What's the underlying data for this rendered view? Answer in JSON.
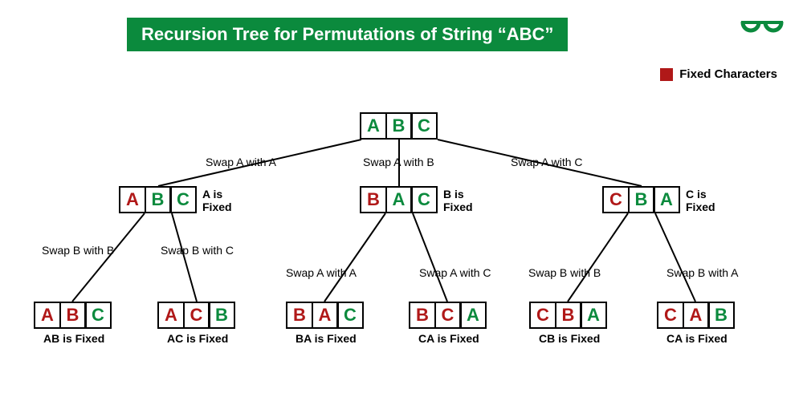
{
  "title": "Recursion Tree for Permutations of String “ABC”",
  "legend": {
    "label": "Fixed Characters",
    "color": "#b01818"
  },
  "chart_data": {
    "type": "tree",
    "description": "Recursion tree showing how the string ABC is permuted by fixing one character at each level and swapping the rest.",
    "root": {
      "cells": [
        {
          "char": "A",
          "fixed": false
        },
        {
          "char": "B",
          "fixed": false
        },
        {
          "char": "C",
          "fixed": false
        }
      ],
      "children": [
        {
          "edge_label": "Swap A with A",
          "side_label": "A is Fixed",
          "cells": [
            {
              "char": "A",
              "fixed": true
            },
            {
              "char": "B",
              "fixed": false
            },
            {
              "char": "C",
              "fixed": false
            }
          ],
          "children": [
            {
              "edge_label": "Swap B with B",
              "leaf_label": "AB is Fixed",
              "cells": [
                {
                  "char": "A",
                  "fixed": true
                },
                {
                  "char": "B",
                  "fixed": true
                },
                {
                  "char": "C",
                  "fixed": false
                }
              ]
            },
            {
              "edge_label": "Swap B with C",
              "leaf_label": "AC is Fixed",
              "cells": [
                {
                  "char": "A",
                  "fixed": true
                },
                {
                  "char": "C",
                  "fixed": true
                },
                {
                  "char": "B",
                  "fixed": false
                }
              ]
            }
          ]
        },
        {
          "edge_label": "Swap A with B",
          "side_label": "B is Fixed",
          "cells": [
            {
              "char": "B",
              "fixed": true
            },
            {
              "char": "A",
              "fixed": false
            },
            {
              "char": "C",
              "fixed": false
            }
          ],
          "children": [
            {
              "edge_label": "Swap A with A",
              "leaf_label": "BA is Fixed",
              "cells": [
                {
                  "char": "B",
                  "fixed": true
                },
                {
                  "char": "A",
                  "fixed": true
                },
                {
                  "char": "C",
                  "fixed": false
                }
              ]
            },
            {
              "edge_label": "Swap A with C",
              "leaf_label": "CA is Fixed",
              "cells": [
                {
                  "char": "B",
                  "fixed": true
                },
                {
                  "char": "C",
                  "fixed": true
                },
                {
                  "char": "A",
                  "fixed": false
                }
              ]
            }
          ]
        },
        {
          "edge_label": "Swap A with C",
          "side_label": "C is Fixed",
          "cells": [
            {
              "char": "C",
              "fixed": true
            },
            {
              "char": "B",
              "fixed": false
            },
            {
              "char": "A",
              "fixed": false
            }
          ],
          "children": [
            {
              "edge_label": "Swap B with B",
              "leaf_label": "CB is Fixed",
              "cells": [
                {
                  "char": "C",
                  "fixed": true
                },
                {
                  "char": "B",
                  "fixed": true
                },
                {
                  "char": "A",
                  "fixed": false
                }
              ]
            },
            {
              "edge_label": "Swap B with A",
              "leaf_label": "CA is Fixed",
              "cells": [
                {
                  "char": "C",
                  "fixed": true
                },
                {
                  "char": "A",
                  "fixed": true
                },
                {
                  "char": "B",
                  "fixed": false
                }
              ]
            }
          ]
        }
      ]
    }
  }
}
